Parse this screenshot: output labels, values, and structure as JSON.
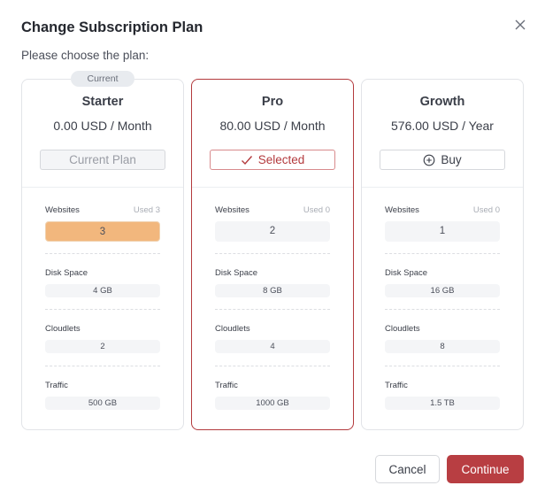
{
  "dialog": {
    "title": "Change Subscription Plan",
    "subtitle": "Please choose the plan:",
    "close_icon": "close-icon"
  },
  "plans": [
    {
      "name": "Starter",
      "price": "0.00 USD / Month",
      "badge": "Current",
      "action_label": "Current Plan",
      "action_state": "current",
      "resources": {
        "websites": {
          "label": "Websites",
          "used": "Used 3",
          "value": "3",
          "over_limit": true
        },
        "disk": {
          "label": "Disk Space",
          "value": "4 GB"
        },
        "cloudlets": {
          "label": "Cloudlets",
          "value": "2"
        },
        "traffic": {
          "label": "Traffic",
          "value": "500 GB"
        }
      }
    },
    {
      "name": "Pro",
      "price": "80.00 USD / Month",
      "action_label": "Selected",
      "action_icon": "check-icon",
      "action_state": "selected",
      "resources": {
        "websites": {
          "label": "Websites",
          "used": "Used 0",
          "value": "2"
        },
        "disk": {
          "label": "Disk Space",
          "value": "8 GB"
        },
        "cloudlets": {
          "label": "Cloudlets",
          "value": "4"
        },
        "traffic": {
          "label": "Traffic",
          "value": "1000 GB"
        }
      }
    },
    {
      "name": "Growth",
      "price": "576.00 USD / Year",
      "action_label": "Buy",
      "action_icon": "plus-circle-icon",
      "action_state": "buy",
      "resources": {
        "websites": {
          "label": "Websites",
          "used": "Used 0",
          "value": "1"
        },
        "disk": {
          "label": "Disk Space",
          "value": "16 GB"
        },
        "cloudlets": {
          "label": "Cloudlets",
          "value": "8"
        },
        "traffic": {
          "label": "Traffic",
          "value": "1.5 TB"
        }
      }
    }
  ],
  "footer": {
    "cancel_label": "Cancel",
    "continue_label": "Continue"
  },
  "colors": {
    "accent": "#b83e42",
    "warning": "#f2b77d"
  }
}
